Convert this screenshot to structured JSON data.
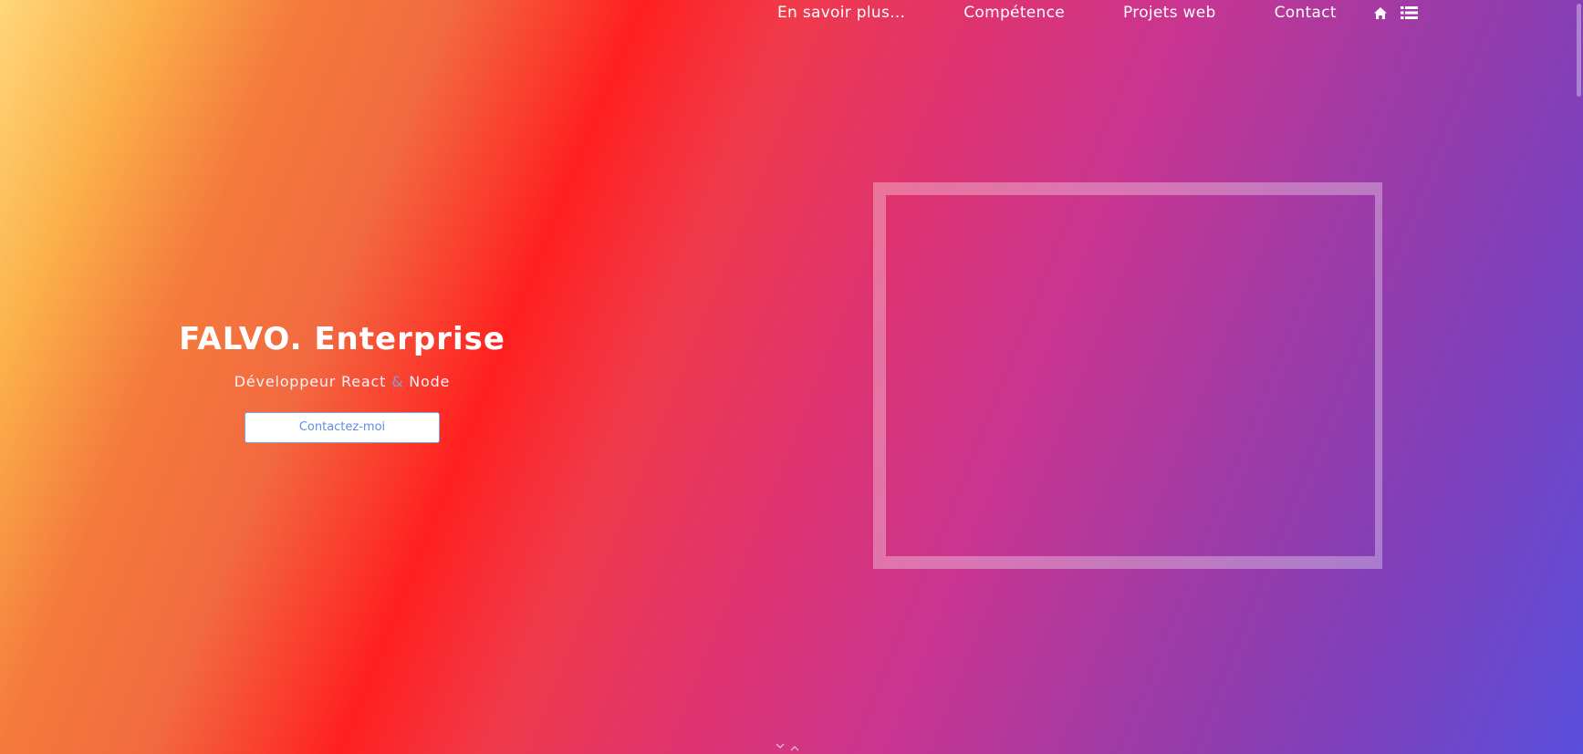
{
  "nav": {
    "links": [
      "En savoir plus...",
      "Compétence",
      "Projets web",
      "Contact"
    ],
    "icons": [
      "home-icon",
      "list-icon"
    ]
  },
  "hero": {
    "title": "FALVO. Enterprise",
    "subtitle_part1": "Développeur React",
    "subtitle_amp": "&",
    "subtitle_part2": "Node",
    "button_label": "Contactez-moi"
  },
  "colors": {
    "accent_blue": "#5b8fe0",
    "ampersand": "#8a9bd8",
    "text": "#ffffff"
  }
}
